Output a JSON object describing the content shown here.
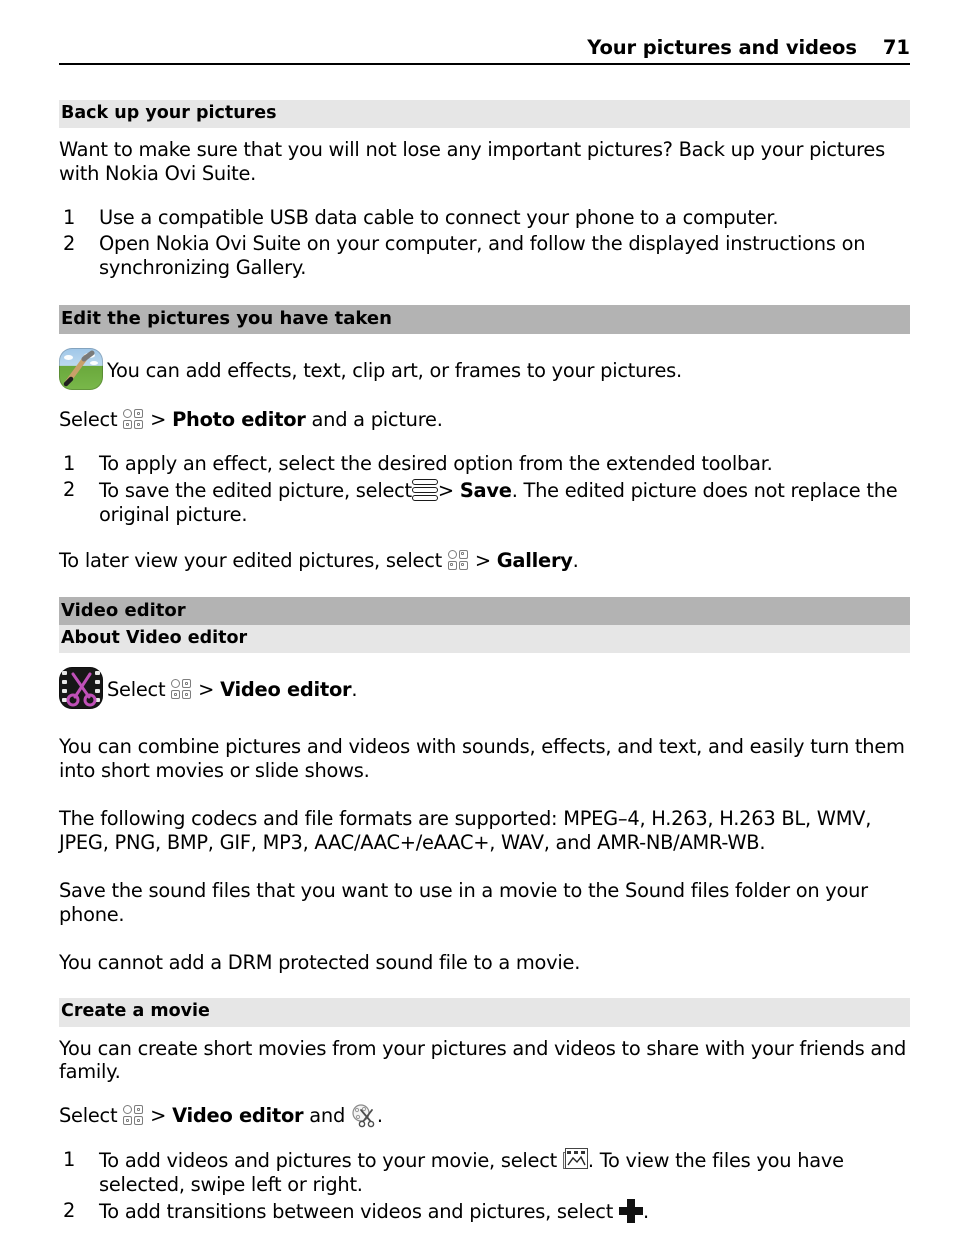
{
  "header": {
    "title": "Your pictures and videos",
    "page_number": "71"
  },
  "sections": [
    {
      "heading": "Back up your pictures",
      "heading_level": 3,
      "intro": "Want to make sure that you will not lose any important pictures? Back up your pictures with Nokia Ovi Suite.",
      "steps": [
        {
          "num": "1",
          "text": "Use a compatible USB data cable to connect your phone to a computer."
        },
        {
          "num": "2",
          "text": "Open Nokia Ovi Suite on your computer, and follow the displayed instructions on synchronizing Gallery."
        }
      ]
    },
    {
      "heading": "Edit the pictures you have taken",
      "heading_level": 2,
      "icon_line": "You can add effects, text, clip art, or frames to your pictures.",
      "select_line": {
        "prefix": "Select",
        "separator": ">",
        "target": "Photo editor",
        "suffix": "and a picture."
      },
      "steps": [
        {
          "num": "1",
          "text": "To apply an effect, select the desired option from the extended toolbar."
        },
        {
          "num": "2",
          "text_before": "To save the edited picture, select",
          "separator": ">",
          "target": "Save",
          "text_after": ". The edited picture does not replace the original picture."
        }
      ],
      "closing": {
        "prefix": "To later view your edited pictures, select",
        "separator": ">",
        "target": "Gallery",
        "suffix": "."
      }
    },
    {
      "heading": "Video editor",
      "heading_level": 2
    },
    {
      "heading": "About Video editor",
      "heading_level": 3,
      "select_line": {
        "prefix": "Select",
        "separator": ">",
        "target": "Video editor",
        "suffix": "."
      },
      "paragraphs": [
        "You can combine pictures and videos with sounds, effects, and text, and easily turn them into short movies or slide shows.",
        "The following codecs and file formats are supported: MPEG–4, H.263, H.263 BL, WMV, JPEG, PNG, BMP, GIF, MP3, AAC/AAC+/eAAC+, WAV, and AMR-NB/AMR-WB.",
        "Save the sound files that you want to use in a movie to the Sound files folder on your phone.",
        "You cannot add a DRM protected sound file to a movie."
      ]
    },
    {
      "heading": "Create a movie",
      "heading_level": 3,
      "intro": "You can create short movies from your pictures and videos to share with your friends and family.",
      "select_line": {
        "prefix": "Select",
        "separator": ">",
        "target": "Video editor",
        "middle": "and",
        "suffix": "."
      },
      "steps": [
        {
          "num": "1",
          "text_before": "To add videos and pictures to your movie, select",
          "text_after": ". To view the files you have selected, swipe left or right."
        },
        {
          "num": "2",
          "text_before": "To add transitions between videos and pictures, select",
          "text_after": "."
        }
      ]
    }
  ],
  "icons": {
    "menu_grid": "app-menu-grid-icon",
    "options_bars": "options-menu-icon",
    "photo_editor_app": "photo-editor-app-icon",
    "video_editor_app": "video-editor-app-icon",
    "scissors_small": "video-editor-scissors-icon",
    "add_media": "add-media-picture-icon",
    "add_transition": "add-transition-plus-icon"
  },
  "colors": {
    "heading_level2_bg": "#b3b3b3",
    "heading_level3_bg": "#e6e6e6",
    "text": "#000000",
    "page_bg": "#ffffff"
  }
}
